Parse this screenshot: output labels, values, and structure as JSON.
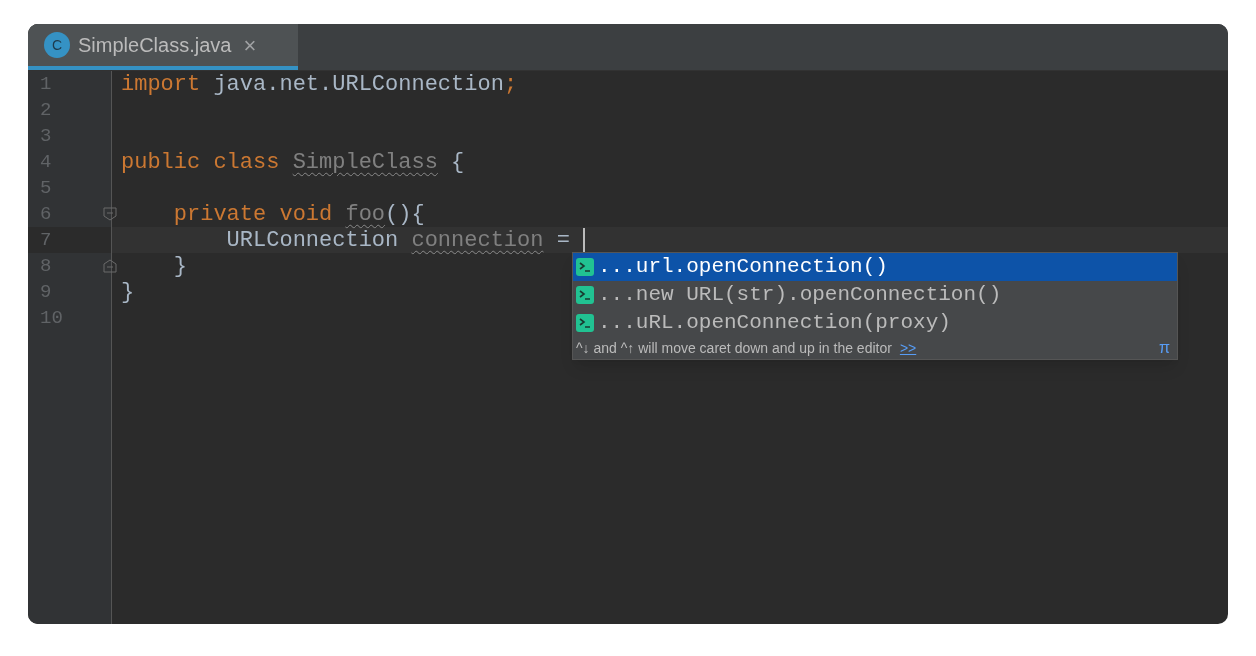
{
  "tab": {
    "title": "SimpleClass.java",
    "icon_letter": "C",
    "close": "×",
    "selected": true
  },
  "lines": [
    {
      "number": "1",
      "kind": "code",
      "tokens": [
        {
          "text": "import",
          "kind": "keyword"
        },
        {
          "text": " java.net.URLConnection",
          "kind": "plain"
        },
        {
          "text": ";",
          "kind": "keyword"
        }
      ]
    },
    {
      "number": "2",
      "kind": "code"
    },
    {
      "number": "3",
      "kind": "code"
    },
    {
      "number": "4",
      "kind": "code",
      "tokens": [
        {
          "text": "public class ",
          "kind": "keyword"
        },
        {
          "text": "SimpleClass",
          "kind": "unused"
        },
        {
          "text": " {",
          "kind": "plain"
        }
      ]
    },
    {
      "number": "5",
      "kind": "code"
    },
    {
      "number": "6",
      "kind": "fold_start",
      "tokens": [
        {
          "text": "    private void ",
          "kind": "keyword"
        },
        {
          "text": "foo",
          "kind": "unused"
        },
        {
          "text": "(){",
          "kind": "plain"
        }
      ]
    },
    {
      "number": "7",
      "kind": "code",
      "current": true,
      "caret": true,
      "tokens": [
        {
          "text": "        URLConnection ",
          "kind": "plain"
        },
        {
          "text": "connection",
          "kind": "unused"
        },
        {
          "text": " = ",
          "kind": "plain"
        }
      ]
    },
    {
      "number": "8",
      "kind": "fold_end",
      "tokens": [
        {
          "text": "    }",
          "kind": "plain"
        }
      ]
    },
    {
      "number": "9",
      "kind": "code",
      "tokens": [
        {
          "text": "}",
          "kind": "plain"
        }
      ]
    },
    {
      "number": "10",
      "kind": "code"
    }
  ],
  "completion": {
    "items": [
      {
        "text": "...url.openConnection()",
        "selected": true
      },
      {
        "text": "...new URL(str).openConnection()",
        "selected": false
      },
      {
        "text": "...uRL.openConnection(proxy)",
        "selected": false
      }
    ],
    "hint": "^↓ and ^↑ will move caret down and up in the editor",
    "hint_link": ">>",
    "pi": "π"
  }
}
